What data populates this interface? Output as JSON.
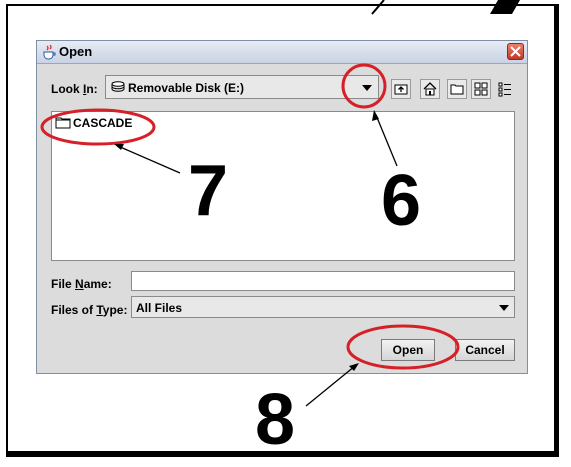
{
  "dialog": {
    "title": "Open",
    "look_in_label_pre": "Look ",
    "look_in_label_key": "I",
    "look_in_label_post": "n:",
    "look_in_value": "Removable Disk (E:)",
    "files": [
      "CASCADE"
    ],
    "file_name_label_pre": "File ",
    "file_name_label_key": "N",
    "file_name_label_post": "ame:",
    "file_name_value": "",
    "files_of_type_label_pre": "Files of ",
    "files_of_type_label_key": "T",
    "files_of_type_label_post": "ype:",
    "files_of_type_value": "All Files",
    "open_button": "Open",
    "cancel_button": "Cancel"
  },
  "callouts": {
    "six": "6",
    "seven": "7",
    "eight": "8"
  },
  "colors": {
    "highlight_ellipse": "#d62027",
    "title_bar": "#c9d3e4",
    "dialog_bg": "#dcdcdc"
  },
  "icons": {
    "title": "java-cup-icon",
    "close": "close-icon",
    "disk": "disk-icon",
    "up_folder": "up-folder-icon",
    "home": "home-icon",
    "new_folder": "new-folder-icon",
    "list_view": "list-view-icon",
    "details_view": "details-view-icon",
    "folder": "folder-icon"
  }
}
